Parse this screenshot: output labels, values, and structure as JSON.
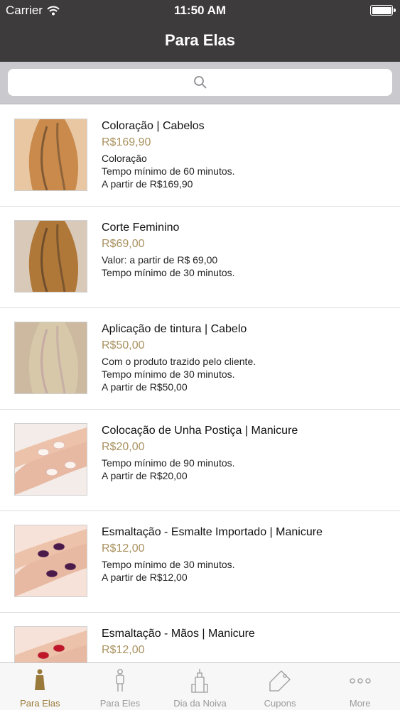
{
  "status_bar": {
    "carrier": "Carrier",
    "time": "11:50 AM"
  },
  "nav": {
    "title": "Para Elas"
  },
  "search": {
    "placeholder": ""
  },
  "colors": {
    "bar": "#3d3b3b",
    "price": "#a99260",
    "active_tab": "#9a7a3a",
    "inactive_tab": "#9a9a9a"
  },
  "services": [
    {
      "name": "Coloração | Cabelos",
      "price": "R$169,90",
      "description": [
        "Coloração",
        "Tempo mínimo de 60 minutos.",
        "A partir de R$169,90"
      ],
      "image": "hair-photo"
    },
    {
      "name": "Corte Feminino",
      "price": "R$69,00",
      "description": [
        "Valor: a partir de R$ 69,00",
        "Tempo mínimo de 30 minutos."
      ],
      "image": "hair-photo"
    },
    {
      "name": "Aplicação de tintura | Cabelo",
      "price": "R$50,00",
      "description": [
        "Com o produto trazido pelo cliente.",
        "Tempo mínimo de 30 minutos.",
        "A partir de R$50,00"
      ],
      "image": "hair-photo"
    },
    {
      "name": "Colocação de Unha Postiça | Manicure",
      "price": "R$20,00",
      "description": [
        "Tempo mínimo de 90 minutos.",
        "A partir de R$20,00"
      ],
      "image": "nails-photo"
    },
    {
      "name": "Esmaltação - Esmalte Importado | Manicure",
      "price": "R$12,00",
      "description": [
        "Tempo mínimo de 30 minutos.",
        "A partir de R$12,00"
      ],
      "image": "nails-photo"
    },
    {
      "name": "Esmaltação - Mãos | Manicure",
      "price": "R$12,00",
      "description": [],
      "image": "nails-photo"
    }
  ],
  "tabs": [
    {
      "label": "Para Elas",
      "icon": "woman-icon",
      "active": true
    },
    {
      "label": "Para Eles",
      "icon": "man-icon",
      "active": false
    },
    {
      "label": "Dia da Noiva",
      "icon": "building-icon",
      "active": false
    },
    {
      "label": "Cupons",
      "icon": "tag-icon",
      "active": false
    },
    {
      "label": "More",
      "icon": "more-icon",
      "active": false
    }
  ]
}
